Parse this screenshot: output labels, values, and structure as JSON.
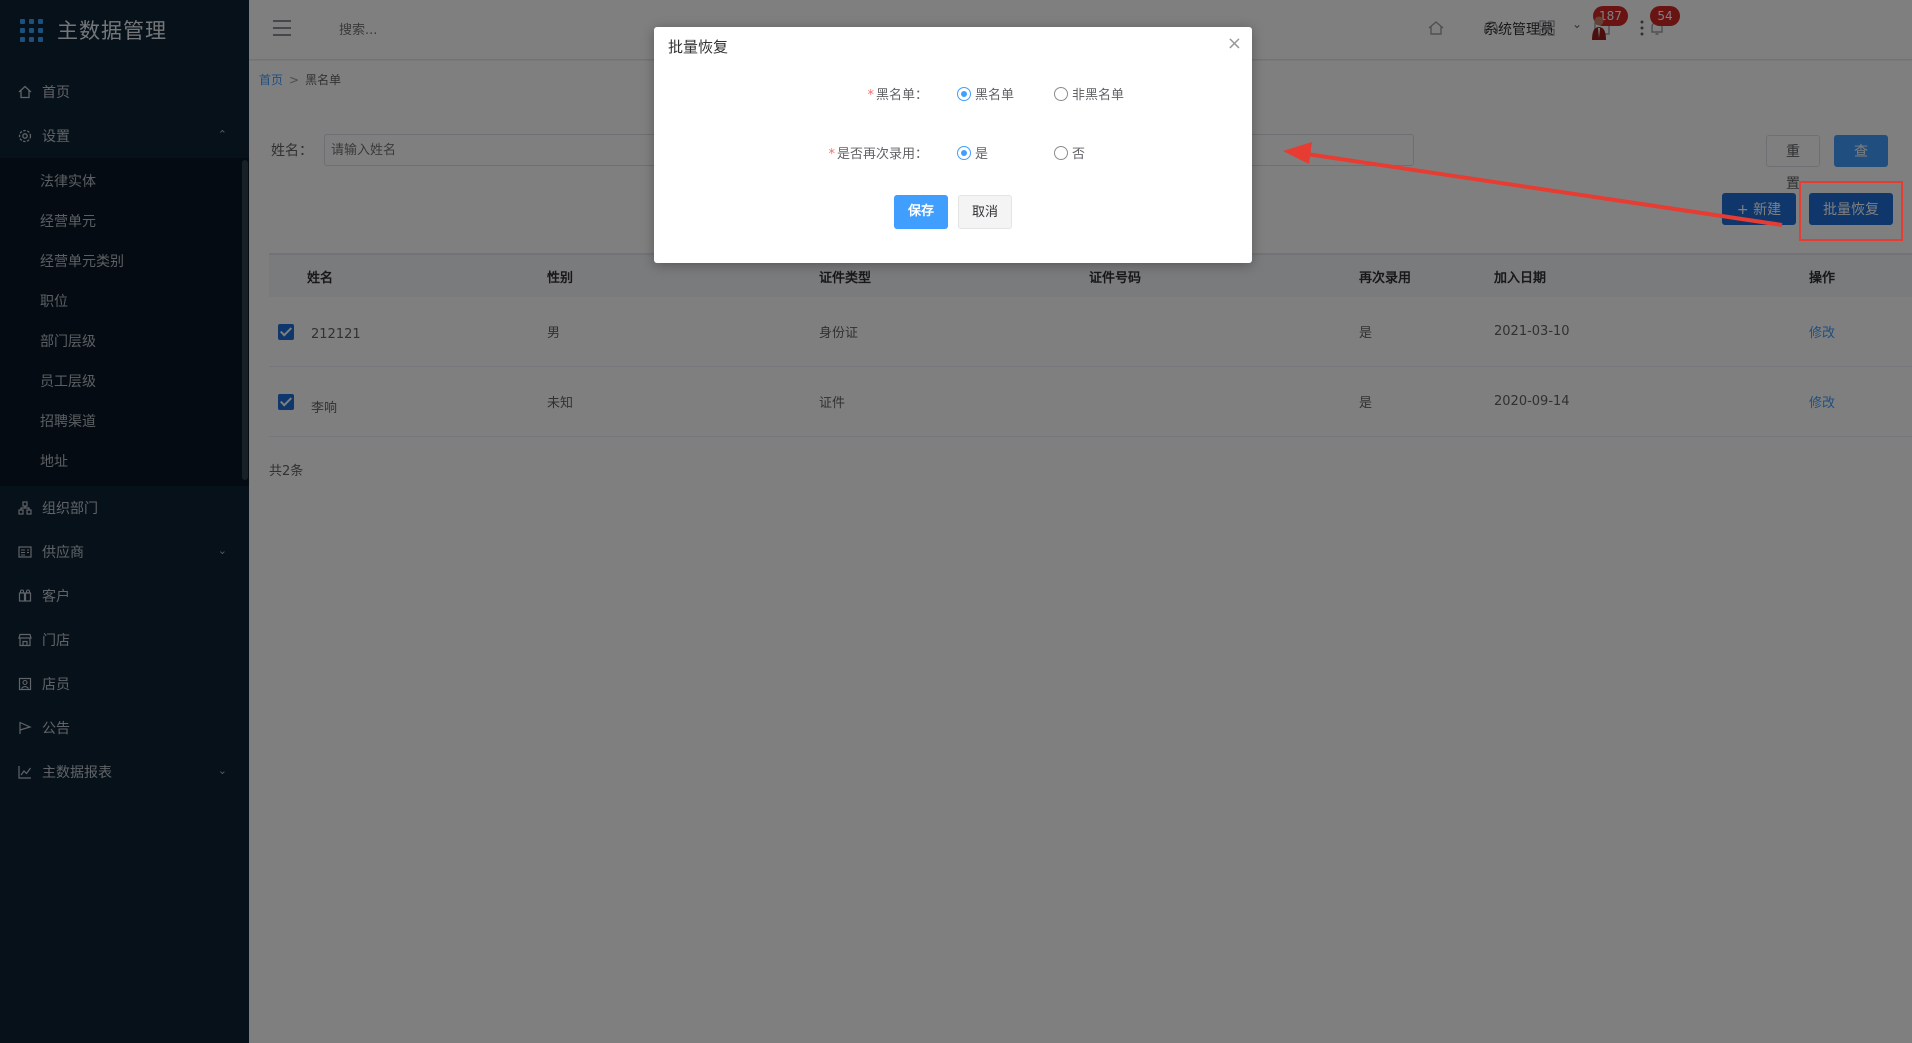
{
  "app": {
    "title": "主数据管理"
  },
  "sidebar": {
    "items": [
      {
        "label": "首页",
        "icon": "home-icon"
      },
      {
        "label": "设置",
        "icon": "gear-icon",
        "expanded": true,
        "children": [
          "法律实体",
          "经营单元",
          "经营单元类别",
          "职位",
          "部门层级",
          "员工层级",
          "招聘渠道",
          "地址"
        ]
      },
      {
        "label": "组织部门",
        "icon": "org-icon"
      },
      {
        "label": "供应商",
        "icon": "supplier-icon",
        "expandable": true
      },
      {
        "label": "客户",
        "icon": "customer-icon"
      },
      {
        "label": "门店",
        "icon": "store-icon"
      },
      {
        "label": "店员",
        "icon": "clerk-icon"
      },
      {
        "label": "公告",
        "icon": "flag-icon"
      },
      {
        "label": "主数据报表",
        "icon": "chart-icon",
        "expandable": true
      }
    ]
  },
  "header": {
    "search_placeholder": "搜索...",
    "badges": {
      "messages": "187",
      "notifications": "54"
    },
    "user_name": "系统管理员"
  },
  "breadcrumb": {
    "home": "首页",
    "separator": ">",
    "current": "黑名单"
  },
  "filter": {
    "name_label": "姓名：",
    "name_placeholder": "请输入姓名",
    "reset_label": "重置",
    "query_label": "查询"
  },
  "actions": {
    "new_label": "新建",
    "batch_restore_label": "批量恢复"
  },
  "table": {
    "headers": [
      "姓名",
      "性别",
      "证件类型",
      "证件号码",
      "再次录用",
      "加入日期",
      "操作"
    ],
    "rows": [
      {
        "name": "212121",
        "gender": "男",
        "id_type": "身份证",
        "id_number": "",
        "rehire": "是",
        "join_date": "2021-03-10",
        "action": "修改",
        "checked": true
      },
      {
        "name": "李响",
        "gender": "未知",
        "id_type": "证件",
        "id_number": "",
        "rehire": "是",
        "join_date": "2020-09-14",
        "action": "修改",
        "checked": true
      }
    ],
    "total": "共2条"
  },
  "dialog": {
    "title": "批量恢复",
    "blacklist_label": "黑名单：",
    "blacklist_options": [
      "黑名单",
      "非黑名单"
    ],
    "blacklist_selected": "黑名单",
    "rehire_label": "是否再次录用：",
    "rehire_options": [
      "是",
      "否"
    ],
    "rehire_selected": "是",
    "save_label": "保存",
    "cancel_label": "取消",
    "close_symbol": "×"
  },
  "colors": {
    "primary": "#409eff",
    "sidebar_bg": "#0e2335",
    "annotation": "#e63c32",
    "badge": "#d32626"
  }
}
